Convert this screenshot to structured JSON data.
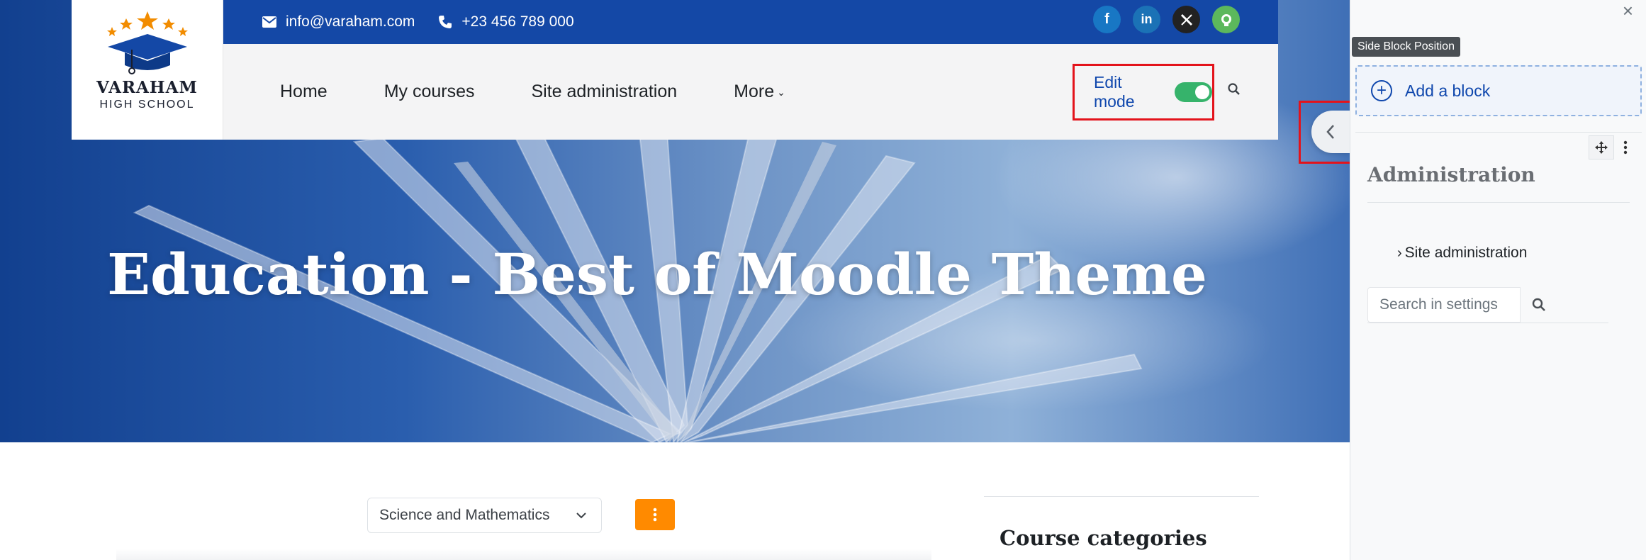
{
  "brand": {
    "name": "VARAHAM",
    "subtitle": "HIGH SCHOOL",
    "star_color": "#f28c00",
    "cap_color": "#1448a6"
  },
  "contact": {
    "email": "info@varaham.com",
    "phone": "+23 456 789 000"
  },
  "socials": [
    {
      "name": "facebook-icon",
      "glyph": "f",
      "color": "#1877c4"
    },
    {
      "name": "linkedin-icon",
      "glyph": "in",
      "color": "#1b72b6"
    },
    {
      "name": "x-icon",
      "glyph": "𝕏",
      "color": "#222222"
    },
    {
      "name": "github-icon",
      "glyph": "",
      "color": "#5cb85c"
    }
  ],
  "nav": {
    "items": [
      "Home",
      "My courses",
      "Site administration",
      "More"
    ],
    "edit_mode_label": "Edit mode",
    "edit_mode_on": true
  },
  "hero": {
    "title": "Education - Best of Moodle Theme"
  },
  "drawer": {
    "tooltip": "Side Block Position",
    "add_block_label": "Add a block",
    "block_title": "Administration",
    "tree_item": "Site administration",
    "search_placeholder": "Search in settings"
  },
  "content": {
    "category_selected": "Science and Mathematics",
    "course_categories_title": "Course categories"
  },
  "colors": {
    "accent": "#1448a6",
    "highlight": "#e3131b",
    "toggle_on": "#36b36b",
    "options_button": "#ff8a00"
  }
}
